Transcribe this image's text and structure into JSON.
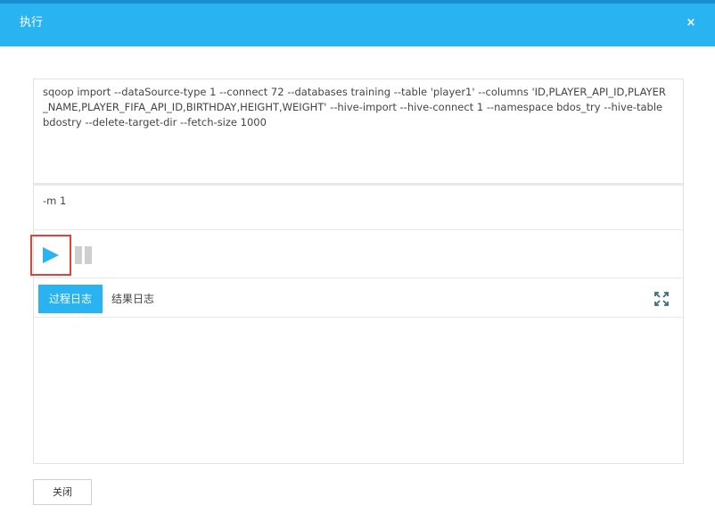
{
  "dialog": {
    "title": "执行",
    "close_symbol": "×"
  },
  "editor": {
    "command": "sqoop import  --dataSource-type 1 --connect 72 --databases training --table 'player1' --columns 'ID,PLAYER_API_ID,PLAYER_NAME,PLAYER_FIFA_API_ID,BIRTHDAY,HEIGHT,WEIGHT' --hive-import --hive-connect 1 --namespace bdos_try --hive-table bdostry --delete-target-dir  --fetch-size 1000",
    "params": "-m 1"
  },
  "controls": {
    "play_icon": "play-icon",
    "pause_icon": "pause-icon",
    "play_highlight_color": "#e4413a"
  },
  "tabs": {
    "process_log": "过程日志",
    "result_log": "结果日志",
    "expand_icon": "expand-icon"
  },
  "footer": {
    "close_label": "关闭"
  },
  "colors": {
    "accent": "#29b3f1",
    "play": "#29b3f1",
    "pause": "#cfcfcf"
  }
}
